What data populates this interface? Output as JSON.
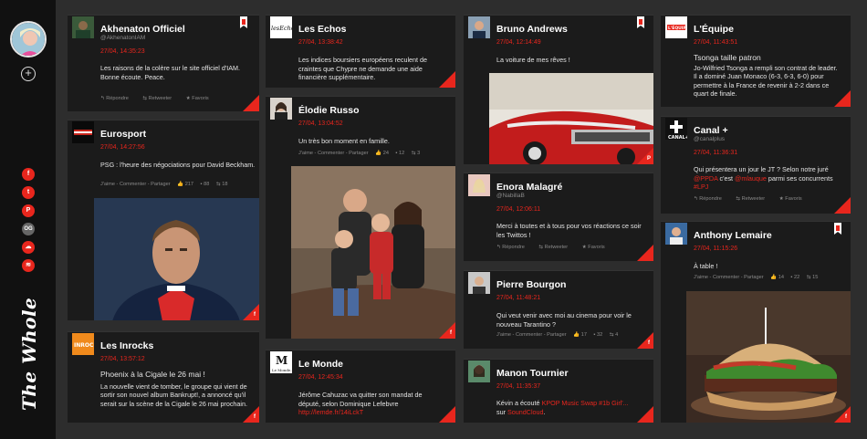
{
  "brand": "The Whole",
  "colors": {
    "accent": "#e8261d",
    "card": "#1b1b1b",
    "bg": "#2d2d2d",
    "sidebar": "#111111"
  },
  "sidebar": {
    "add_icon": "plus-circle-icon",
    "social": [
      {
        "glyph": "f",
        "icon": "facebook-icon"
      },
      {
        "glyph": "t",
        "icon": "twitter-icon"
      },
      {
        "glyph": "P",
        "icon": "pinterest-icon"
      },
      {
        "glyph": "OG",
        "icon": "opengraph-icon"
      },
      {
        "glyph": "☁",
        "icon": "soundcloud-icon"
      },
      {
        "glyph": "≋",
        "icon": "rss-icon"
      }
    ]
  },
  "actions": {
    "reply": "Répondre",
    "retweet": "Retweeter",
    "favorite": "Favoris",
    "fb_line": "J'aime - Commenter - Partager"
  },
  "cards": {
    "akhenaton": {
      "name": "Akhenaton Officiel",
      "handle": "@AkhenatonIAM",
      "time": "27/04, 14:35:23",
      "text": "Les raisons de la colère sur le site officiel d'IAM. Bonne écoute. Peace.",
      "source": "twitter"
    },
    "eurosport": {
      "name": "Eurosport",
      "time": "27/04, 14:27:56",
      "text": "PSG : l'heure des négociations pour David Beckham.",
      "likes": "217",
      "comments": "88",
      "shares": "18",
      "source": "facebook"
    },
    "inrocks": {
      "name": "Les Inrocks",
      "time": "27/04, 13:57:12",
      "headline": "Phoenix à la Cigale le 26 mai !",
      "text": "La nouvelle vient de tomber, le groupe qui vient de sortir son nouvel album Bankrupt!, a annoncé qu'il serait sur la scène de la Cigale le 26 mai prochain.",
      "source": "facebook"
    },
    "echos": {
      "name": "Les Echos",
      "time": "27/04, 13:38:42",
      "text": "Les indices boursiers européens reculent de craintes que Chypre ne demande une aide financière supplémentaire.",
      "source": "rss"
    },
    "elodie": {
      "name": "Élodie Russo",
      "time": "27/04, 13:04:52",
      "text": "Un très bon moment en famille.",
      "likes": "24",
      "comments": "12",
      "shares": "3",
      "source": "facebook"
    },
    "monde": {
      "name": "Le Monde",
      "time": "27/04, 12:45:34",
      "text": "Jérôme Cahuzac va quitter son mandat de député, selon Dominique Lefebvre",
      "link": "http://lemde.fr/14iLckT",
      "source": "rss"
    },
    "bruno": {
      "name": "Bruno Andrews",
      "time": "27/04, 12:14:49",
      "text": "La voiture de mes rêves !",
      "source": "pinterest"
    },
    "enora": {
      "name": "Enora Malagré",
      "handle": "@NabillaB",
      "time": "27/04, 12:06:11",
      "text": "Merci à toutes et à tous pour vos réactions ce soir les Twittos !",
      "source": "twitter"
    },
    "pierre": {
      "name": "Pierre Bourgon",
      "time": "27/04, 11:48:21",
      "text": "Qui veut venir avec moi au cinema pour voir le nouveau Tarantino ?",
      "likes": "17",
      "comments": "32",
      "shares": "4",
      "source": "facebook"
    },
    "manon": {
      "name": "Manon Tournier",
      "time": "27/04, 11:35:37",
      "text_pre": "Kévin a écouté ",
      "track": "KPOP Music Swap #1b Girl'...",
      "text_mid": " sur ",
      "platform": "SoundCloud",
      "text_post": ".",
      "source": "soundcloud"
    },
    "equipe": {
      "name": "L'Équipe",
      "time": "27/04, 11:43:51",
      "headline": "Tsonga taille patron",
      "text": "Jo-Wilfried Tsonga a rempli son contrat de leader. Il a dominé Juan Monaco (6-3, 6-3, 6-0) pour permettre à la France de revenir à 2-2 dans ce quart de finale.",
      "source": "rss"
    },
    "canal": {
      "name": "Canal +",
      "handle": "@canalplus",
      "time": "27/04, 11:36:31",
      "text_pre": "Qui présentera un jour le JT ? Selon notre juré ",
      "mention1": "@PPDA",
      "text_mid": " c'est ",
      "mention2": "@mlauque",
      "text_mid2": " parmi ses concurrents ",
      "hashtag": "#LPJ",
      "source": "twitter"
    },
    "anthony": {
      "name": "Anthony Lemaire",
      "time": "27/04, 11:15:26",
      "text": "À table !",
      "likes": "14",
      "comments": "22",
      "shares": "15",
      "source": "facebook"
    }
  }
}
